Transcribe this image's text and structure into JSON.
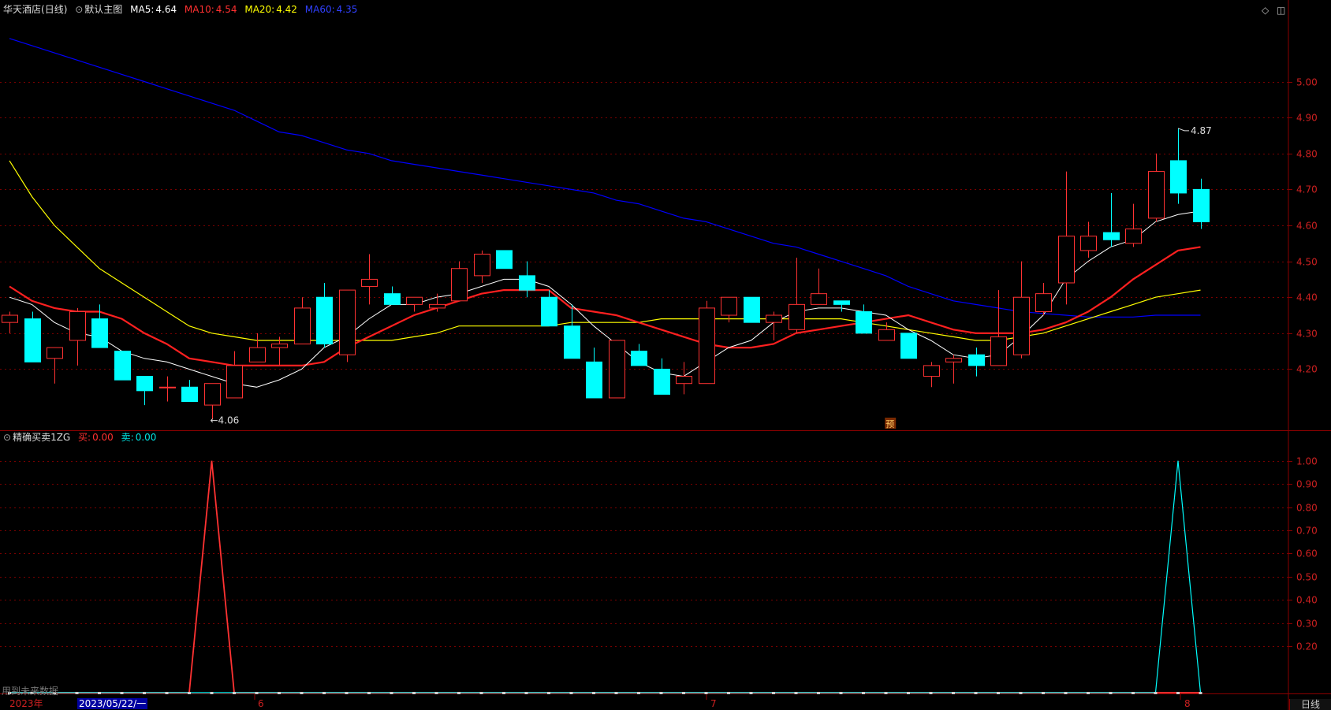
{
  "header": {
    "stock_name": "华天酒店",
    "period": "(日线)",
    "template": "默认主图",
    "ma5_label": "MA5:",
    "ma5_value": "4.64",
    "ma10_label": "MA10:",
    "ma10_value": "4.54",
    "ma20_label": "MA20:",
    "ma20_value": "4.42",
    "ma60_label": "MA60:",
    "ma60_value": "4.35"
  },
  "indicator": {
    "name": "精确买卖1ZG",
    "buy_label": "买:",
    "buy_value": "0.00",
    "sell_label": "卖:",
    "sell_value": "0.00"
  },
  "bottom_bar": {
    "future_data": "用到未来数据",
    "year_label": "2023年",
    "date_cursor": "2023/05/22/一",
    "months": [
      "6",
      "7",
      "8"
    ],
    "period_tab": "日线"
  },
  "annotations": {
    "high_label": "4.87",
    "low_label": "←4.06",
    "pre_badge": "预"
  },
  "colors": {
    "background": "#000000",
    "up": "#ff3232",
    "down": "#00ffff",
    "ma5": "#ffffff",
    "ma10": "#ff2020",
    "ma20": "#ffff00",
    "ma60": "#0000ff",
    "axis": "#8b0000",
    "grid": "#7a0000"
  },
  "chart_data": [
    {
      "type": "candlestick",
      "title": "华天酒店 (日线)",
      "ylim": [
        4.03,
        5.17
      ],
      "yticks": [
        4.2,
        4.3,
        4.4,
        4.5,
        4.6,
        4.7,
        4.8,
        4.9,
        5.0
      ],
      "ohlc": [
        [
          4.33,
          4.36,
          4.3,
          4.35
        ],
        [
          4.34,
          4.36,
          4.22,
          4.22
        ],
        [
          4.23,
          4.26,
          4.16,
          4.26
        ],
        [
          4.28,
          4.37,
          4.21,
          4.36
        ],
        [
          4.34,
          4.38,
          4.26,
          4.26
        ],
        [
          4.25,
          4.25,
          4.17,
          4.17
        ],
        [
          4.18,
          4.18,
          4.1,
          4.14
        ],
        [
          4.15,
          4.18,
          4.11,
          4.15
        ],
        [
          4.15,
          4.17,
          4.11,
          4.11
        ],
        [
          4.1,
          4.16,
          4.06,
          4.16
        ],
        [
          4.12,
          4.25,
          4.12,
          4.21
        ],
        [
          4.22,
          4.3,
          4.22,
          4.26
        ],
        [
          4.26,
          4.29,
          4.21,
          4.27
        ],
        [
          4.27,
          4.4,
          4.27,
          4.37
        ],
        [
          4.4,
          4.44,
          4.26,
          4.27
        ],
        [
          4.24,
          4.42,
          4.22,
          4.42
        ],
        [
          4.43,
          4.52,
          4.38,
          4.45
        ],
        [
          4.41,
          4.43,
          4.38,
          4.38
        ],
        [
          4.38,
          4.4,
          4.36,
          4.4
        ],
        [
          4.37,
          4.41,
          4.36,
          4.38
        ],
        [
          4.39,
          4.5,
          4.39,
          4.48
        ],
        [
          4.46,
          4.53,
          4.44,
          4.52
        ],
        [
          4.53,
          4.53,
          4.48,
          4.48
        ],
        [
          4.46,
          4.5,
          4.4,
          4.42
        ],
        [
          4.4,
          4.42,
          4.32,
          4.32
        ],
        [
          4.32,
          4.38,
          4.23,
          4.23
        ],
        [
          4.22,
          4.26,
          4.12,
          4.12
        ],
        [
          4.12,
          4.28,
          4.12,
          4.28
        ],
        [
          4.25,
          4.27,
          4.21,
          4.21
        ],
        [
          4.2,
          4.23,
          4.13,
          4.13
        ],
        [
          4.16,
          4.22,
          4.13,
          4.18
        ],
        [
          4.16,
          4.39,
          4.16,
          4.37
        ],
        [
          4.35,
          4.4,
          4.33,
          4.4
        ],
        [
          4.4,
          4.4,
          4.33,
          4.33
        ],
        [
          4.33,
          4.36,
          4.28,
          4.35
        ],
        [
          4.31,
          4.51,
          4.3,
          4.38
        ],
        [
          4.38,
          4.48,
          4.38,
          4.41
        ],
        [
          4.39,
          4.39,
          4.36,
          4.38
        ],
        [
          4.36,
          4.38,
          4.3,
          4.3
        ],
        [
          4.28,
          4.33,
          4.28,
          4.31
        ],
        [
          4.3,
          4.3,
          4.23,
          4.23
        ],
        [
          4.18,
          4.22,
          4.15,
          4.21
        ],
        [
          4.22,
          4.24,
          4.16,
          4.23
        ],
        [
          4.24,
          4.26,
          4.18,
          4.21
        ],
        [
          4.21,
          4.42,
          4.21,
          4.29
        ],
        [
          4.24,
          4.5,
          4.23,
          4.4
        ],
        [
          4.36,
          4.44,
          4.35,
          4.41
        ],
        [
          4.44,
          4.75,
          4.38,
          4.57
        ],
        [
          4.53,
          4.61,
          4.51,
          4.57
        ],
        [
          4.58,
          4.69,
          4.54,
          4.56
        ],
        [
          4.55,
          4.66,
          4.54,
          4.59
        ],
        [
          4.62,
          4.8,
          4.61,
          4.75
        ],
        [
          4.78,
          4.87,
          4.66,
          4.69
        ],
        [
          4.7,
          4.73,
          4.59,
          4.61
        ]
      ],
      "ma5": [
        4.4,
        4.38,
        4.33,
        4.3,
        4.29,
        4.25,
        4.23,
        4.22,
        4.2,
        4.18,
        4.16,
        4.15,
        4.17,
        4.2,
        4.26,
        4.29,
        4.34,
        4.38,
        4.38,
        4.4,
        4.41,
        4.43,
        4.45,
        4.45,
        4.43,
        4.38,
        4.32,
        4.27,
        4.22,
        4.19,
        4.18,
        4.22,
        4.26,
        4.28,
        4.33,
        4.36,
        4.37,
        4.37,
        4.36,
        4.35,
        4.31,
        4.28,
        4.24,
        4.23,
        4.24,
        4.29,
        4.35,
        4.45,
        4.5,
        4.54,
        4.56,
        4.61,
        4.63,
        4.64
      ],
      "ma10": [
        4.43,
        4.39,
        4.37,
        4.36,
        4.36,
        4.34,
        4.3,
        4.27,
        4.23,
        4.22,
        4.21,
        4.21,
        4.21,
        4.21,
        4.22,
        4.26,
        4.29,
        4.32,
        4.35,
        4.37,
        4.39,
        4.41,
        4.42,
        4.42,
        4.42,
        4.37,
        4.36,
        4.35,
        4.33,
        4.31,
        4.29,
        4.27,
        4.26,
        4.26,
        4.27,
        4.3,
        4.31,
        4.32,
        4.33,
        4.34,
        4.35,
        4.33,
        4.31,
        4.3,
        4.3,
        4.3,
        4.31,
        4.33,
        4.36,
        4.4,
        4.45,
        4.49,
        4.53,
        4.54
      ],
      "ma20": [
        4.78,
        4.68,
        4.6,
        4.54,
        4.48,
        4.44,
        4.4,
        4.36,
        4.32,
        4.3,
        4.29,
        4.28,
        4.28,
        4.28,
        4.28,
        4.28,
        4.28,
        4.28,
        4.29,
        4.3,
        4.32,
        4.32,
        4.32,
        4.32,
        4.32,
        4.33,
        4.33,
        4.33,
        4.33,
        4.34,
        4.34,
        4.34,
        4.34,
        4.34,
        4.34,
        4.34,
        4.34,
        4.34,
        4.33,
        4.32,
        4.31,
        4.3,
        4.29,
        4.28,
        4.28,
        4.29,
        4.3,
        4.32,
        4.34,
        4.36,
        4.38,
        4.4,
        4.41,
        4.42
      ],
      "ma60": [
        5.12,
        5.1,
        5.08,
        5.06,
        5.04,
        5.02,
        5.0,
        4.98,
        4.96,
        4.94,
        4.92,
        4.89,
        4.86,
        4.85,
        4.83,
        4.81,
        4.8,
        4.78,
        4.77,
        4.76,
        4.75,
        4.74,
        4.73,
        4.72,
        4.71,
        4.7,
        4.69,
        4.67,
        4.66,
        4.64,
        4.62,
        4.61,
        4.59,
        4.57,
        4.55,
        4.54,
        4.52,
        4.5,
        4.48,
        4.46,
        4.43,
        4.41,
        4.39,
        4.38,
        4.37,
        4.36,
        4.355,
        4.35,
        4.345,
        4.345,
        4.345,
        4.35,
        4.35,
        4.35
      ]
    },
    {
      "type": "line",
      "title": "精确买卖1ZG",
      "ylim": [
        0,
        1.05
      ],
      "yticks": [
        0.2,
        0.3,
        0.4,
        0.5,
        0.6,
        0.7,
        0.8,
        0.9,
        1.0
      ],
      "series": [
        {
          "name": "买",
          "values": [
            0,
            0,
            0,
            0,
            0,
            0,
            0,
            0,
            0,
            1,
            0,
            0,
            0,
            0,
            0,
            0,
            0,
            0,
            0,
            0,
            0,
            0,
            0,
            0,
            0,
            0,
            0,
            0,
            0,
            0,
            0,
            0,
            0,
            0,
            0,
            0,
            0,
            0,
            0,
            0,
            0,
            0,
            0,
            0,
            0,
            0,
            0,
            0,
            0,
            0,
            0,
            0,
            0,
            0
          ]
        },
        {
          "name": "卖",
          "values": [
            0,
            0,
            0,
            0,
            0,
            0,
            0,
            0,
            0,
            0,
            0,
            0,
            0,
            0,
            0,
            0,
            0,
            0,
            0,
            0,
            0,
            0,
            0,
            0,
            0,
            0,
            0,
            0,
            0,
            0,
            0,
            0,
            0,
            0,
            0,
            0,
            0,
            0,
            0,
            0,
            0,
            0,
            0,
            0,
            0,
            0,
            0,
            0,
            0,
            0,
            0,
            0,
            1,
            0
          ]
        }
      ]
    }
  ]
}
